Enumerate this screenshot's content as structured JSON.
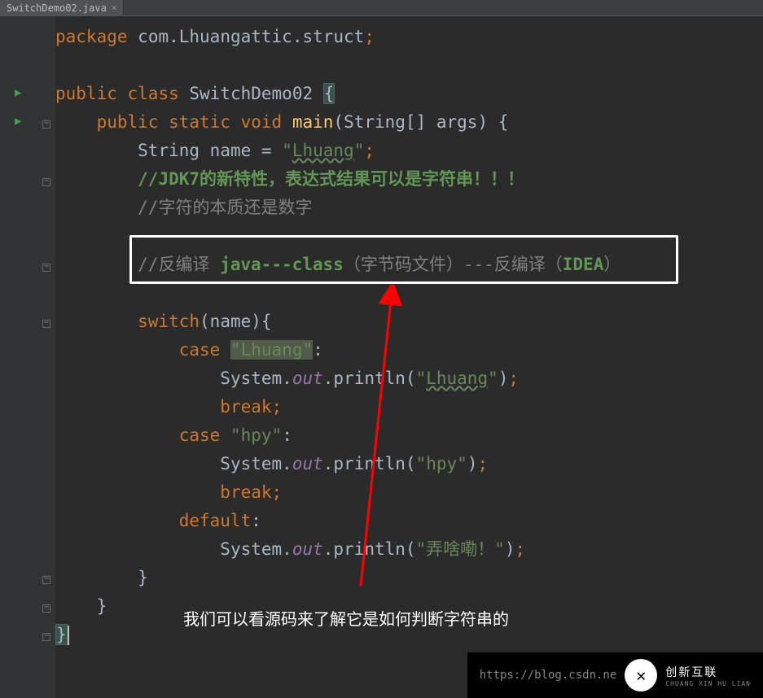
{
  "tab": {
    "filename": "SwitchDemo02.java"
  },
  "code": {
    "pkg_kw": "package",
    "pkg_val": "com.Lhuangattic.struct",
    "pub": "public",
    "class_kw": "class",
    "class_name": "SwitchDemo02",
    "static_kw": "static",
    "void_kw": "void",
    "main": "main",
    "main_params": "String[] args",
    "string_type": "String",
    "name_var": "name",
    "name_val": "Lhuang",
    "comment1": "//JDK7的新特性，表达式结果可以是字符串！！！",
    "comment2": "//字符的本质还是数字",
    "comment3_pre": "//反编译",
    "comment3_java": "java---class",
    "comment3_mid": "（字节码文件）---反编译（",
    "comment3_idea": "IDEA",
    "comment3_end": "）",
    "switch_kw": "switch",
    "case_kw": "case",
    "case1_val": "Lhuang",
    "case2_val": "hpy",
    "default_kw": "default",
    "system": "System",
    "out": "out",
    "println": "println",
    "print1": "Lhuang",
    "print2": "hpy",
    "print3": "弄啥嘞！",
    "break_kw": "break"
  },
  "annotation": "我们可以看源码来了解它是如何判断字符串的",
  "watermark": {
    "url": "https://blog.csdn.ne",
    "brand": "创新互联",
    "brand_sub": "CHUANG XIN HU LIAN"
  }
}
